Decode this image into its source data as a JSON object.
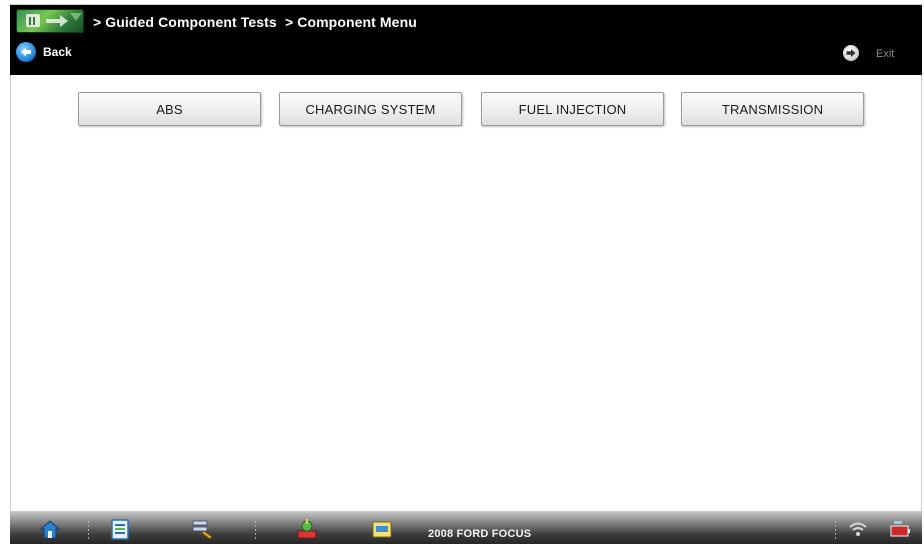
{
  "header": {
    "breadcrumb": [
      "> Guided Component Tests",
      "> Component Menu"
    ],
    "back_label": "Back",
    "exit_label": "Exit"
  },
  "menu": {
    "items": [
      {
        "label": "ABS"
      },
      {
        "label": "CHARGING SYSTEM"
      },
      {
        "label": "FUEL INJECTION"
      },
      {
        "label": "TRANSMISSION"
      }
    ]
  },
  "taskbar": {
    "vehicle": "2008 FORD FOCUS",
    "icons": [
      "home-icon",
      "vehicle-info-icon",
      "tools-icon",
      "component-tests-icon",
      "data-icon",
      "wifi-icon",
      "battery-icon"
    ]
  },
  "colors": {
    "header_bg": "#000000",
    "button_bg": "#eeeeee",
    "accent_green": "#5ab847",
    "back_blue": "#2a8fe0"
  }
}
